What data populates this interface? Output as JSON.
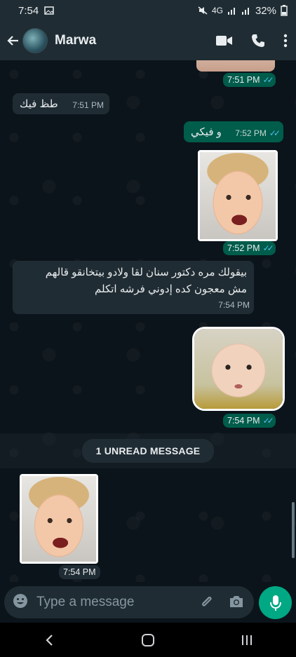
{
  "status_bar": {
    "time": "7:54",
    "network": "4G",
    "battery": "32%"
  },
  "header": {
    "contact_name": "Marwa",
    "icons": [
      "back-arrow-icon",
      "video-call-icon",
      "phone-icon",
      "more-vertical-icon"
    ]
  },
  "messages": [
    {
      "type": "image",
      "direction": "out",
      "time": "7:51 PM",
      "read": true
    },
    {
      "type": "text",
      "direction": "in",
      "text": "طظ فيك",
      "time": "7:51 PM"
    },
    {
      "type": "text",
      "direction": "out",
      "text": "و فيكي",
      "time": "7:52 PM",
      "read": true
    },
    {
      "type": "sticker",
      "direction": "out",
      "time": "7:52 PM",
      "read": true
    },
    {
      "type": "text",
      "direction": "in",
      "line1": "بيقولك مره دكتور سنان لقا ولادو بيتخانقو قالهم",
      "line2": "مش  معجون كده إدوني فرشه اتكلم",
      "time": "7:54 PM"
    },
    {
      "type": "sticker",
      "direction": "out",
      "time": "7:54 PM",
      "read": true
    },
    {
      "type": "sticker",
      "direction": "in",
      "time": "7:54 PM"
    }
  ],
  "unread_divider": "1 UNREAD MESSAGE",
  "composer": {
    "placeholder": "Type a message"
  },
  "colors": {
    "outgoing_bubble": "#005c4b",
    "incoming_bubble": "#202c33",
    "read_tick": "#53bdeb",
    "accent": "#00a884"
  }
}
